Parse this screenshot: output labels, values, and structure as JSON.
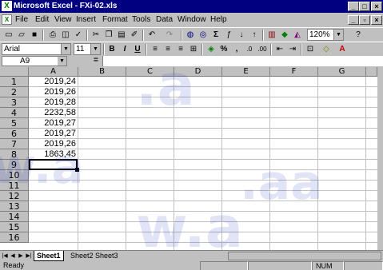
{
  "window": {
    "title": "Microsoft Excel - FXi-02.xls",
    "app_icon": "excel-icon"
  },
  "menubar": {
    "items": [
      "File",
      "Edit",
      "View",
      "Insert",
      "Format",
      "Tools",
      "Data",
      "Window",
      "Help"
    ]
  },
  "toolbar": {
    "zoom": "120%",
    "font_name": "Arial",
    "font_size": "11"
  },
  "formula_bar": {
    "name_box": "A9",
    "equals": "=",
    "content": ""
  },
  "grid": {
    "columns": [
      "A",
      "B",
      "C",
      "D",
      "E",
      "F",
      "G"
    ],
    "rows": [
      "1",
      "2",
      "3",
      "4",
      "5",
      "6",
      "7",
      "8",
      "9",
      "10",
      "11",
      "12",
      "13",
      "14",
      "15",
      "16"
    ],
    "column_a_values": [
      "2019,24",
      "2019,26",
      "2019,28",
      "2232,58",
      "2019,27",
      "2019,27",
      "2019,26",
      "1863,45"
    ],
    "selected_cell": "A9"
  },
  "sheets": {
    "tabs": [
      "Sheet1",
      "Sheet2",
      "Sheet3"
    ],
    "active": "Sheet1"
  },
  "status": {
    "left": "Ready",
    "num": "NUM"
  },
  "colors": {
    "titlebar": "#000080",
    "chrome": "#c0c0c0",
    "watermark": "#1428be"
  }
}
